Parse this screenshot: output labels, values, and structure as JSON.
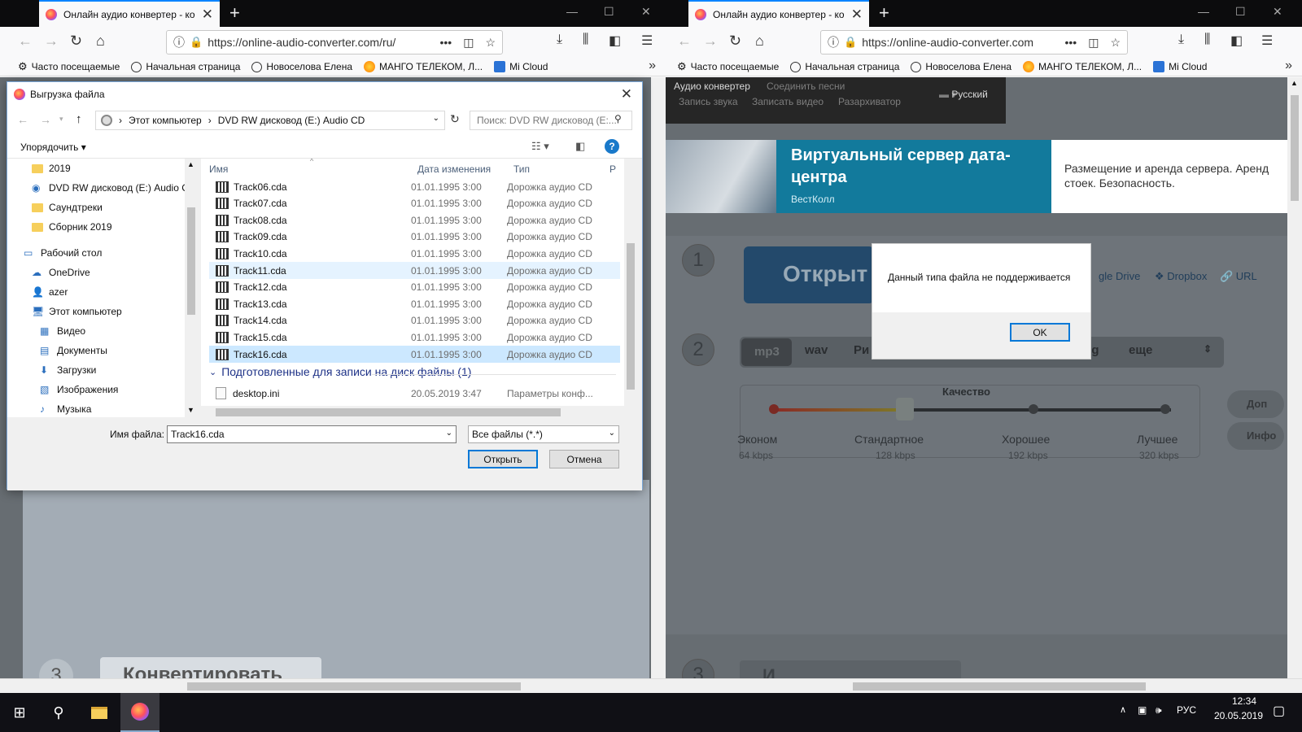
{
  "left_browser": {
    "tab_title": "Онлайн аудио конвертер - ко",
    "url": "https://online-audio-converter.com/ru/",
    "bookmarks": [
      "Часто посещаемые",
      "Начальная страница",
      "Новоселова Елена",
      "МАНГО ТЕЛЕКОМ, Л...",
      "Mi Cloud"
    ],
    "page_convert": "Конвертировать",
    "page_step": "3"
  },
  "file_dialog": {
    "title": "Выгрузка файла",
    "path": [
      "Этот компьютер",
      "DVD RW дисковод (E:) Audio CD"
    ],
    "search_placeholder": "Поиск: DVD RW дисковод (E:...",
    "organize": "Упорядочить",
    "tree": [
      {
        "label": "2019",
        "icon": "folder-icon"
      },
      {
        "label": "DVD RW дисковод (E:) Audio C",
        "icon": "cd-drive-icon"
      },
      {
        "label": "Саундтреки",
        "icon": "folder-icon"
      },
      {
        "label": "Сборник 2019",
        "icon": "folder-icon"
      },
      {
        "label": "Рабочий стол",
        "icon": "desktop-icon"
      },
      {
        "label": "OneDrive",
        "icon": "onedrive-icon"
      },
      {
        "label": "azer",
        "icon": "user-icon"
      },
      {
        "label": "Этот компьютер",
        "icon": "computer-icon"
      },
      {
        "label": "Видео",
        "icon": "video-icon"
      },
      {
        "label": "Документы",
        "icon": "documents-icon"
      },
      {
        "label": "Загрузки",
        "icon": "downloads-icon"
      },
      {
        "label": "Изображения",
        "icon": "pictures-icon"
      },
      {
        "label": "Музыка",
        "icon": "music-icon"
      }
    ],
    "columns": [
      "Имя",
      "Дата изменения",
      "Тип",
      "Р"
    ],
    "files": [
      {
        "name": "Track06.cda",
        "date": "01.01.1995 3:00",
        "type": "Дорожка аудио CD"
      },
      {
        "name": "Track07.cda",
        "date": "01.01.1995 3:00",
        "type": "Дорожка аудио CD"
      },
      {
        "name": "Track08.cda",
        "date": "01.01.1995 3:00",
        "type": "Дорожка аудио CD"
      },
      {
        "name": "Track09.cda",
        "date": "01.01.1995 3:00",
        "type": "Дорожка аудио CD"
      },
      {
        "name": "Track10.cda",
        "date": "01.01.1995 3:00",
        "type": "Дорожка аудио CD"
      },
      {
        "name": "Track11.cda",
        "date": "01.01.1995 3:00",
        "type": "Дорожка аудио CD"
      },
      {
        "name": "Track12.cda",
        "date": "01.01.1995 3:00",
        "type": "Дорожка аудио CD"
      },
      {
        "name": "Track13.cda",
        "date": "01.01.1995 3:00",
        "type": "Дорожка аудио CD"
      },
      {
        "name": "Track14.cda",
        "date": "01.01.1995 3:00",
        "type": "Дорожка аудио CD"
      },
      {
        "name": "Track15.cda",
        "date": "01.01.1995 3:00",
        "type": "Дорожка аудио CD"
      },
      {
        "name": "Track16.cda",
        "date": "01.01.1995 3:00",
        "type": "Дорожка аудио CD"
      }
    ],
    "group_label": "Подготовленные для записи на диск файлы (1)",
    "group_file": {
      "name": "desktop.ini",
      "date": "20.05.2019 3:47",
      "type": "Параметры конф..."
    },
    "filename_label": "Имя файла:",
    "filename_value": "Track16.cda",
    "filetype_value": "Все файлы (*.*)",
    "open_btn": "Открыть",
    "cancel_btn": "Отмена"
  },
  "right_browser": {
    "tab_title": "Онлайн аудио конвертер - ко",
    "url": "https://online-audio-converter.com",
    "bookmarks": [
      "Часто посещаемые",
      "Начальная страница",
      "Новоселова Елена",
      "МАНГО ТЕЛЕКОМ, Л...",
      "Mi Cloud"
    ],
    "nav": {
      "audio_converter": "Аудио конвертер",
      "join": "Соединить песни",
      "record": "Запись звука",
      "video": "Записать видео",
      "unzip": "Разархиватор",
      "lang": "Русский"
    },
    "ad": {
      "title": "Виртуальный сервер дата-центра",
      "sub": "ВестКолл",
      "text1": "Размещение и аренда сервера. Аренд",
      "text2": "стоек. Безопасность."
    },
    "open_label": "Открыт",
    "sources": [
      "gle Drive",
      "Dropbox",
      "URL"
    ],
    "formats": [
      "mp3",
      "wav",
      "Ри",
      "ogg",
      "еще"
    ],
    "quality_title": "Качество",
    "quality_level": "Стандартное",
    "quality": [
      {
        "label": "Эконом",
        "kbps": "64 kbps"
      },
      {
        "label": "Стандартное",
        "kbps": "128 kbps"
      },
      {
        "label": "Хорошее",
        "kbps": "192 kbps"
      },
      {
        "label": "Лучшее",
        "kbps": "320 kbps"
      }
    ],
    "side_buttons": [
      "Доп",
      "Инфо"
    ],
    "bottom_text": "И",
    "alert_message": "Данный типа файла не поддерживается",
    "alert_ok": "OK"
  },
  "taskbar": {
    "lang": "РУС",
    "time": "12:34",
    "date": "20.05.2019"
  }
}
